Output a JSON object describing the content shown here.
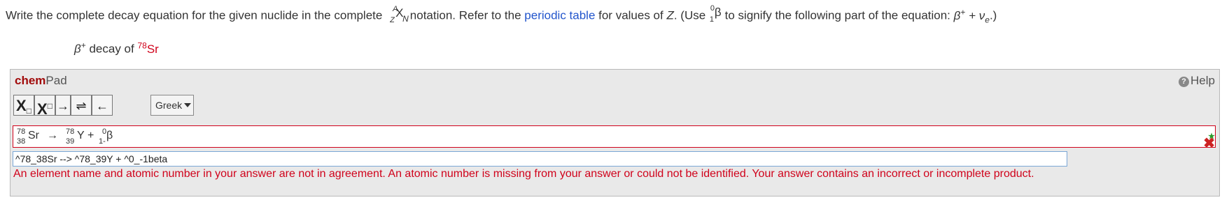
{
  "question": {
    "part1": "Write the complete decay equation for the given nuclide in the complete ",
    "notation": {
      "A": "A",
      "Z": "Z",
      "X": "X",
      "N": "N"
    },
    "part2": " notation. Refer to the ",
    "link": "periodic table",
    "part3": " for values of ",
    "zvar": "Z",
    "part4": ". (Use ",
    "beta_symbol": {
      "top": "0",
      "bottom": "1",
      "glyph": "β"
    },
    "part5": " to signify the following part of the equation: ",
    "eq_beta": "β",
    "eq_plus_sup": "+",
    "eq_middle": " + ν",
    "eq_sub": "e",
    "part6": ".)"
  },
  "prompt": {
    "beta": "β",
    "beta_sup": "+",
    "text": " decay of ",
    "mass": "78",
    "element": "Sr"
  },
  "chempad": {
    "title_bold": "chem",
    "title_rest": "Pad",
    "help_label": "Help",
    "help_icon": "?",
    "toolbar": {
      "subscript": "X",
      "superscript": "X",
      "forward_arrow": "→",
      "equilibrium_arrow": "⇌",
      "reverse_arrow": "←",
      "greek_label": "Greek"
    },
    "rendered": {
      "sr_mass": "78",
      "sr_z": "38",
      "sr_el": "Sr",
      "arrow": "→",
      "y_mass": "78",
      "y_z": "39",
      "y_el": "Y",
      "plus": "+",
      "b_top": "0",
      "b_bottom": "1-",
      "b_el": "β"
    },
    "input_value": "^78_38Sr --> ^78_39Y + ^0_-1beta",
    "feedback": "An element name and atomic number in your answer are not in agreement. An atomic number is missing from your answer or could not be identified. Your answer contains an incorrect or incomplete product."
  }
}
